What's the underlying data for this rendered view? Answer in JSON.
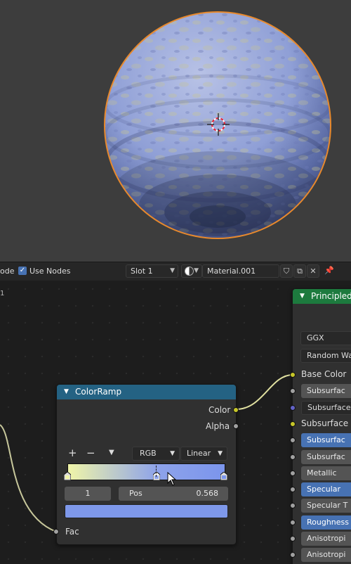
{
  "header": {
    "mode_tail": "ode",
    "use_nodes_label": "Use Nodes",
    "use_nodes_checked": true,
    "slot_label": "Slot 1",
    "material_name": "Material.001",
    "material_icon": "material-sphere-icon",
    "fake_user_icon": "shield-icon",
    "duplicate_icon": "copy-icon",
    "unlink_icon": "close-icon",
    "pin_icon": "pin-icon"
  },
  "editor": {
    "corner_mark": "1"
  },
  "colorramp": {
    "title": "ColorRamp",
    "outputs": [
      "Color",
      "Alpha"
    ],
    "add_label": "+",
    "remove_label": "−",
    "color_mode": "RGB",
    "interpolation": "Linear",
    "stop_index": "1",
    "pos_label": "Pos",
    "pos_value": "0.568",
    "input": "Fac",
    "stops": [
      {
        "position": 0.0,
        "color": "#f0f5a8"
      },
      {
        "position": 0.568,
        "color": "#8ea3ea"
      },
      {
        "position": 1.0,
        "color": "#7b95ec"
      }
    ],
    "active_color": "#7e98ea"
  },
  "principled": {
    "title": "Principled",
    "distribution": "GGX",
    "subsurface_method": "Random Wa",
    "rows": [
      {
        "label": "Base Color",
        "kind": "plain",
        "socket": "#c7c729"
      },
      {
        "label": "Subsurfac",
        "kind": "dark",
        "socket": "#a1a1a1"
      },
      {
        "label": "Subsurface",
        "kind": "field",
        "socket": "#6363c7"
      },
      {
        "label": "Subsurface C",
        "kind": "plain",
        "socket": "#c7c729"
      },
      {
        "label": "Subsurfac",
        "kind": "blue",
        "socket": "#a1a1a1"
      },
      {
        "label": "Subsurfac",
        "kind": "dark",
        "socket": "#a1a1a1"
      },
      {
        "label": "Metallic",
        "kind": "dark",
        "socket": "#a1a1a1"
      },
      {
        "label": "Specular",
        "kind": "blue",
        "socket": "#a1a1a1"
      },
      {
        "label": "Specular T",
        "kind": "dark",
        "socket": "#a1a1a1"
      },
      {
        "label": "Roughness",
        "kind": "blue",
        "socket": "#a1a1a1"
      },
      {
        "label": "Anisotropi",
        "kind": "dark",
        "socket": "#a1a1a1"
      },
      {
        "label": "Anisotropi",
        "kind": "dark",
        "socket": "#a1a1a1"
      }
    ]
  },
  "colors": {
    "viewport_bg": "#3d3d3d",
    "selection_outline": "#e8892c",
    "colorramp_header": "#246283",
    "shader_header": "#1d7a3e",
    "accent_blue": "#4772b3"
  }
}
